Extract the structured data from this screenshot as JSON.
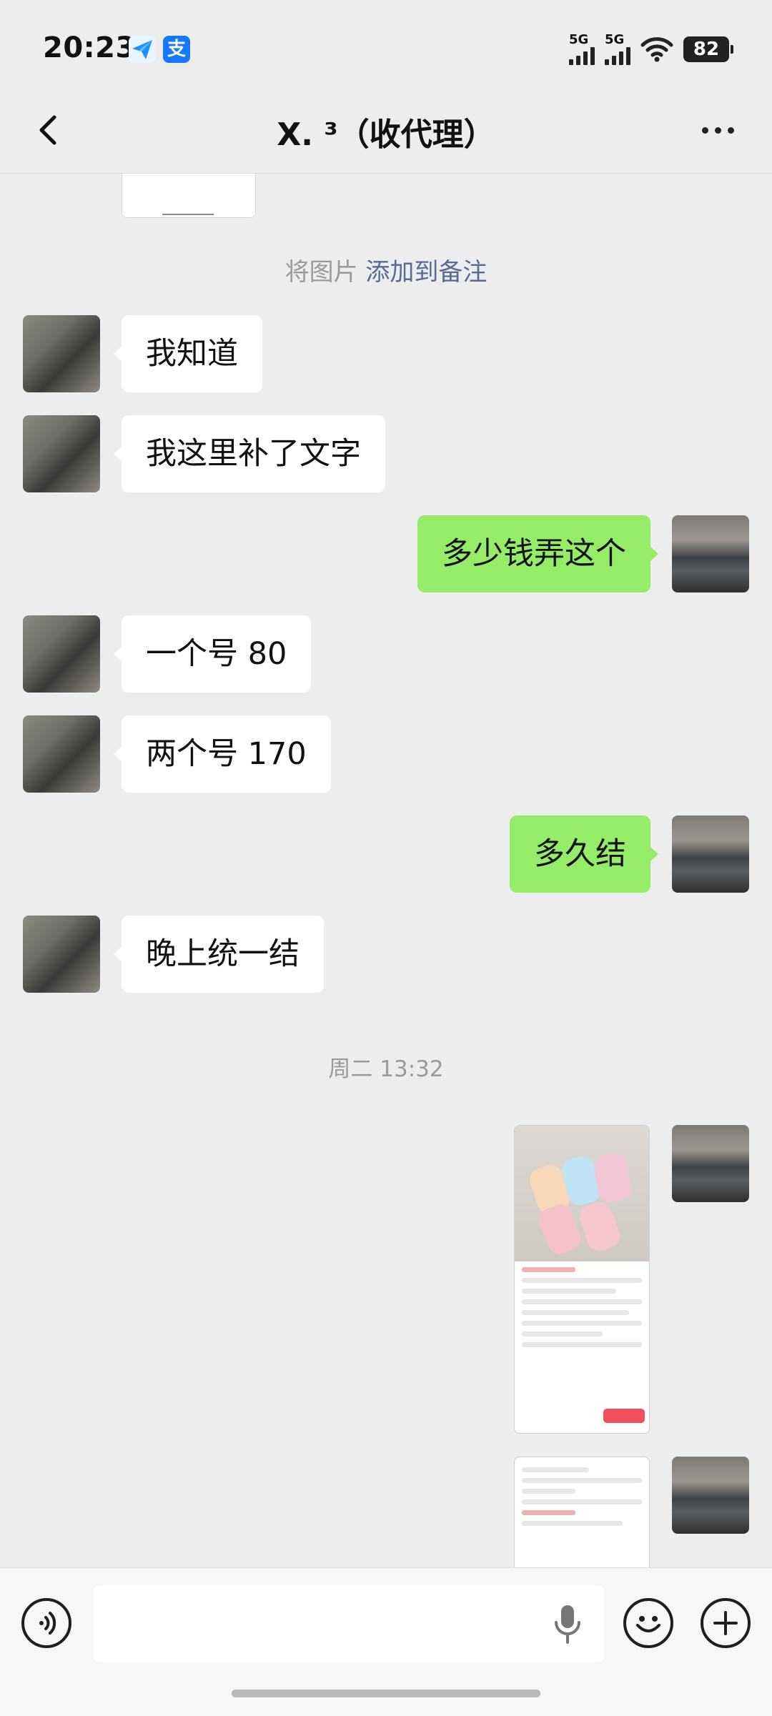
{
  "status_bar": {
    "time": "20:23",
    "network_1": "5G",
    "network_2": "5G",
    "battery": "82",
    "app_icons": [
      "send-app-icon",
      "alipay-icon"
    ],
    "alipay_glyph": "支"
  },
  "header": {
    "title": "X. ³（收代理）"
  },
  "messages": {
    "system_note": "将图片",
    "system_link": "添加到备注",
    "m1": "我知道",
    "m2": "我这里补了文字",
    "m3": "多少钱弄这个",
    "m4": "一个号 80",
    "m5": "两个号 170",
    "m6": "多久结",
    "m7": "晚上统一结",
    "timestamp": "周二 13:32"
  },
  "colors": {
    "chat_bg": "#ededed",
    "incoming_bubble": "#ffffff",
    "outgoing_bubble": "#95ec69",
    "link": "#576b95",
    "muted_text": "#9a9a9a"
  },
  "input_bar": {
    "placeholder": "",
    "icons": [
      "voice-icon",
      "microphone-icon",
      "emoji-icon",
      "plus-icon"
    ]
  }
}
